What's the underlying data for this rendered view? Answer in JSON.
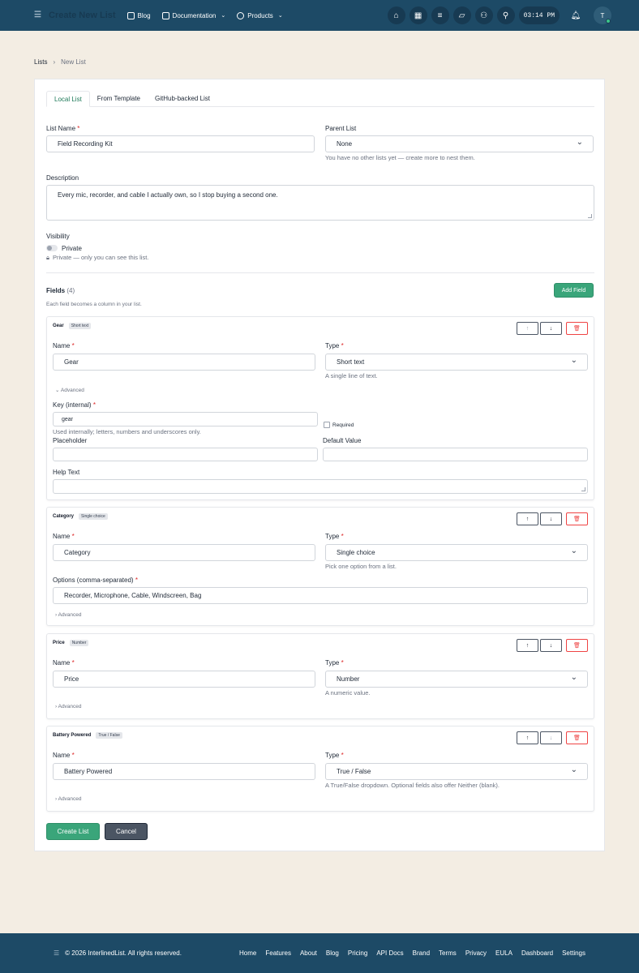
{
  "nav": {
    "title": "Create New List",
    "links": [
      {
        "label": "Blog"
      },
      {
        "label": "Documentation"
      },
      {
        "label": "Products"
      }
    ],
    "clock": "03:14 PM",
    "avatar_initial": "T"
  },
  "breadcrumb": {
    "root": "Lists",
    "current": "New List"
  },
  "tabs": [
    "Local List",
    "From Template",
    "GitHub-backed List"
  ],
  "form": {
    "list_name_label": "List Name",
    "list_name_value": "Field Recording Kit",
    "parent_label": "Parent List",
    "parent_value": "None",
    "parent_hint": "You have no other lists yet — create more to nest them.",
    "description_label": "Description",
    "description_value": "Every mic, recorder, and cable I actually own, so I stop buying a second one.",
    "visibility_label": "Visibility",
    "visibility_value": "Private",
    "visibility_hint": "Private — only you can see this list."
  },
  "fields_section": {
    "title": "Fields",
    "count": "(4)",
    "add_label": "Add Field",
    "hint": "Each field becomes a column in your list."
  },
  "fields": [
    {
      "title": "Gear",
      "badge": "Short text",
      "name_label": "Name",
      "name_value": "Gear",
      "type_label": "Type",
      "type_value": "Short text",
      "type_hint": "A single line of text.",
      "advanced": "⌄ Advanced",
      "key_label": "Key (internal)",
      "key_value": "gear",
      "key_hint": "Used internally; letters, numbers and underscores only.",
      "required_label": "Required",
      "placeholder_label": "Placeholder",
      "default_label": "Default Value",
      "help_label": "Help Text"
    },
    {
      "title": "Category",
      "badge": "Single choice",
      "name_label": "Name",
      "name_value": "Category",
      "type_label": "Type",
      "type_value": "Single choice",
      "type_hint": "Pick one option from a list.",
      "options_label": "Options (comma-separated)",
      "options_value": "Recorder, Microphone, Cable, Windscreen, Bag",
      "advanced": "› Advanced"
    },
    {
      "title": "Price",
      "badge": "Number",
      "name_label": "Name",
      "name_value": "Price",
      "type_label": "Type",
      "type_value": "Number",
      "type_hint": "A numeric value.",
      "advanced": "› Advanced"
    },
    {
      "title": "Battery Powered",
      "badge": "True / False",
      "name_label": "Name",
      "name_value": "Battery Powered",
      "type_label": "Type",
      "type_value": "True / False",
      "type_hint": "A True/False dropdown. Optional fields also offer Neither (blank).",
      "advanced": "› Advanced"
    }
  ],
  "actions": {
    "create": "Create List",
    "cancel": "Cancel"
  },
  "footer": {
    "copyright": "© 2026 InterlinedList. All rights reserved.",
    "links": [
      "Home",
      "Features",
      "About",
      "Blog",
      "Pricing",
      "API Docs",
      "Brand",
      "Terms",
      "Privacy",
      "EULA",
      "Dashboard",
      "Settings"
    ]
  },
  "colors": {
    "nav": "#1d4a66",
    "accent": "#3aa57a",
    "danger": "#ef4444",
    "background": "#f3ede3"
  }
}
